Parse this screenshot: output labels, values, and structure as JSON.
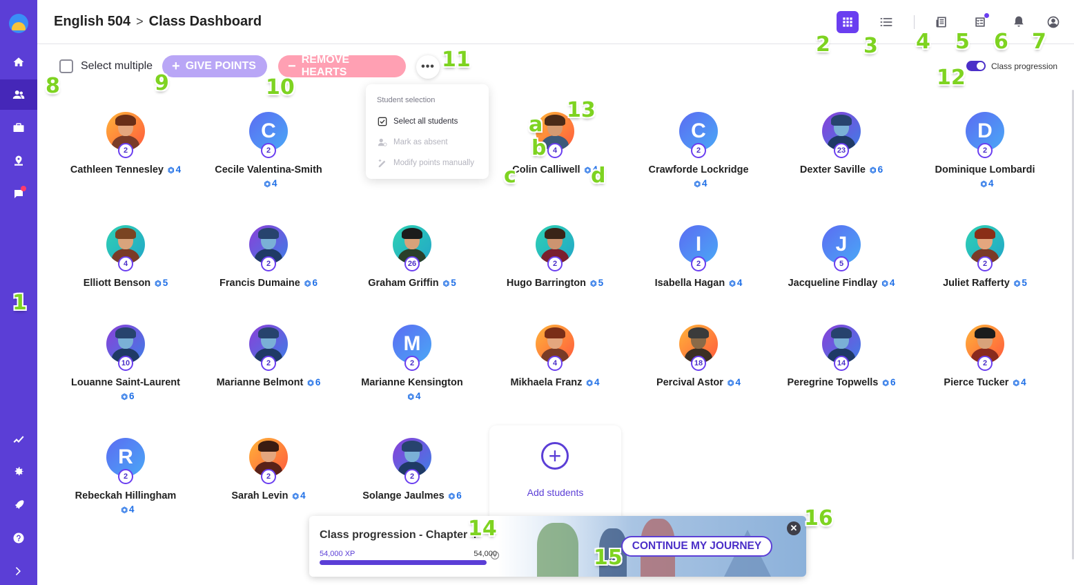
{
  "breadcrumb": {
    "course": "English 504",
    "separator": ">",
    "page": "Class Dashboard"
  },
  "toolbar": {
    "select_multiple_label": "Select multiple",
    "give_points_label": "GIVE POINTS",
    "remove_hearts_label": "REMOVE HEARTS",
    "more_label": "•••"
  },
  "toggle": {
    "label": "Class progression",
    "on": true
  },
  "menu": {
    "title": "Student selection",
    "items": [
      {
        "label": "Select all students",
        "enabled": true,
        "icon": "checkbox-check-icon"
      },
      {
        "label": "Mark as absent",
        "enabled": false,
        "icon": "person-absent-icon"
      },
      {
        "label": "Modify points manually",
        "enabled": false,
        "icon": "edit-points-icon"
      }
    ]
  },
  "students": [
    {
      "name": "Cathleen Tennesley",
      "level": "2",
      "gems": "4"
    },
    {
      "name": "Cecile Valentina-Smith",
      "level": "2",
      "gems": "4",
      "letter": "C"
    },
    {
      "name": "Colin Calliwell",
      "level": "4",
      "gems": "4"
    },
    {
      "name": "Crawforde Lockridge",
      "level": "2",
      "gems": "4",
      "letter": "C"
    },
    {
      "name": "Dexter Saville",
      "level": "23",
      "gems": "6"
    },
    {
      "name": "Dominique Lombardi",
      "level": "2",
      "gems": "4",
      "letter": "D"
    },
    {
      "name": "Elliott Benson",
      "level": "4",
      "gems": "5"
    },
    {
      "name": "Francis Dumaine",
      "level": "2",
      "gems": "6"
    },
    {
      "name": "Graham Griffin",
      "level": "26",
      "gems": "5"
    },
    {
      "name": "Hugo Barrington",
      "level": "2",
      "gems": "5"
    },
    {
      "name": "Isabella Hagan",
      "level": "2",
      "gems": "4",
      "letter": "I"
    },
    {
      "name": "Jacqueline Findlay",
      "level": "5",
      "gems": "4",
      "letter": "J"
    },
    {
      "name": "Juliet Rafferty",
      "level": "2",
      "gems": "5"
    },
    {
      "name": "Louanne Saint-Laurent",
      "level": "10",
      "gems": "6"
    },
    {
      "name": "Marianne Belmont",
      "level": "2",
      "gems": "6"
    },
    {
      "name": "Marianne Kensington",
      "level": "2",
      "gems": "4",
      "letter": "M"
    },
    {
      "name": "Mikhaela Franz",
      "level": "4",
      "gems": "4"
    },
    {
      "name": "Percival Astor",
      "level": "18",
      "gems": "4"
    },
    {
      "name": "Peregrine Topwells",
      "level": "14",
      "gems": "6"
    },
    {
      "name": "Pierce Tucker",
      "level": "2",
      "gems": "4"
    },
    {
      "name": "Rebeckah Hillingham",
      "level": "2",
      "gems": "4",
      "letter": "R"
    },
    {
      "name": "Sarah Levin",
      "level": "2",
      "gems": "4"
    },
    {
      "name": "Solange Jaulmes",
      "level": "2",
      "gems": "6"
    }
  ],
  "add_students_label": "Add students",
  "add_students_icon": "+",
  "banner": {
    "title": "Class progression - Chapter 4",
    "xp_current": "54,000 XP",
    "xp_target": "54,000",
    "xp_progress": 1.0,
    "info_icon": "i",
    "continue_label": "CONTINUE MY JOURNEY",
    "close_icon": "✕"
  },
  "annotations": {
    "m1": "1",
    "m2": "2",
    "m3": "3",
    "m4": "4",
    "m5": "5",
    "m6": "6",
    "m7": "7",
    "m8": "8",
    "m9": "9",
    "m10": "10",
    "m11": "11",
    "m12": "12",
    "m13": "13",
    "m14": "14",
    "m15": "15",
    "m16": "16",
    "ma": "a",
    "mb": "b",
    "mc": "c",
    "md": "d"
  },
  "colors": {
    "sidebar": "#5b3ed6",
    "accent": "#6a3ef0",
    "give_points": "#b9a6f6",
    "remove_hearts": "#ffa0b3",
    "gem": "#1f6fe6",
    "annotation": "#7ed321"
  }
}
